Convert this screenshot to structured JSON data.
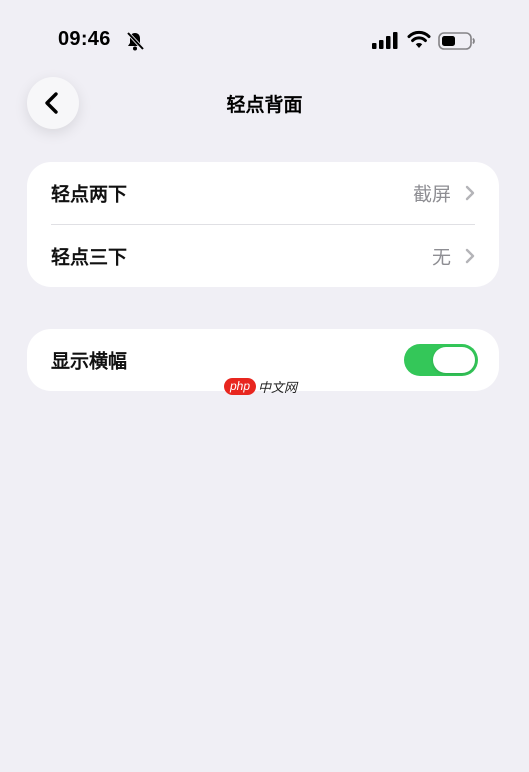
{
  "status_bar": {
    "time": "09:46",
    "icons": [
      "bell-slash-icon",
      "cellular-signal-icon",
      "wifi-icon",
      "battery-icon"
    ]
  },
  "nav": {
    "back_icon": "chevron-left-icon",
    "title": "轻点背面"
  },
  "group_1": {
    "rows": [
      {
        "label": "轻点两下",
        "value": "截屏"
      },
      {
        "label": "轻点三下",
        "value": "无"
      }
    ]
  },
  "group_2": {
    "label": "显示横幅",
    "toggle_on": true
  },
  "watermark": {
    "pill": "php",
    "text": "中文网"
  },
  "colors": {
    "background": "#f0eff5",
    "card": "#ffffff",
    "toggle_on": "#34c759",
    "secondary_text": "#8e8e93"
  }
}
